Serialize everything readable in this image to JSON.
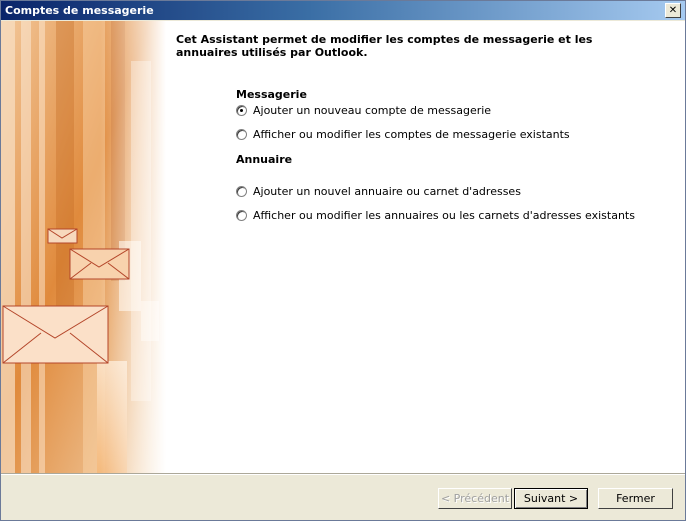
{
  "window": {
    "title": "Comptes de messagerie",
    "close_symbol": "✕"
  },
  "intro": "Cet Assistant permet de modifier les comptes de messagerie et les annuaires utilisés par Outlook.",
  "email_section": {
    "heading": "Messagerie",
    "options": [
      {
        "label": "Ajouter un nouveau compte de messagerie",
        "selected": true
      },
      {
        "label": "Afficher ou modifier les comptes de messagerie existants",
        "selected": false
      }
    ]
  },
  "directory_section": {
    "heading": "Annuaire",
    "options": [
      {
        "label": "Ajouter un nouvel annuaire ou carnet d'adresses",
        "selected": false
      },
      {
        "label": "Afficher ou modifier les annuaires ou les carnets d'adresses existants",
        "selected": false
      }
    ]
  },
  "buttons": {
    "previous": "< Précédent",
    "next": "Suivant >",
    "close": "Fermer"
  },
  "icons": {
    "decorative_envelopes": "envelope-icon"
  }
}
